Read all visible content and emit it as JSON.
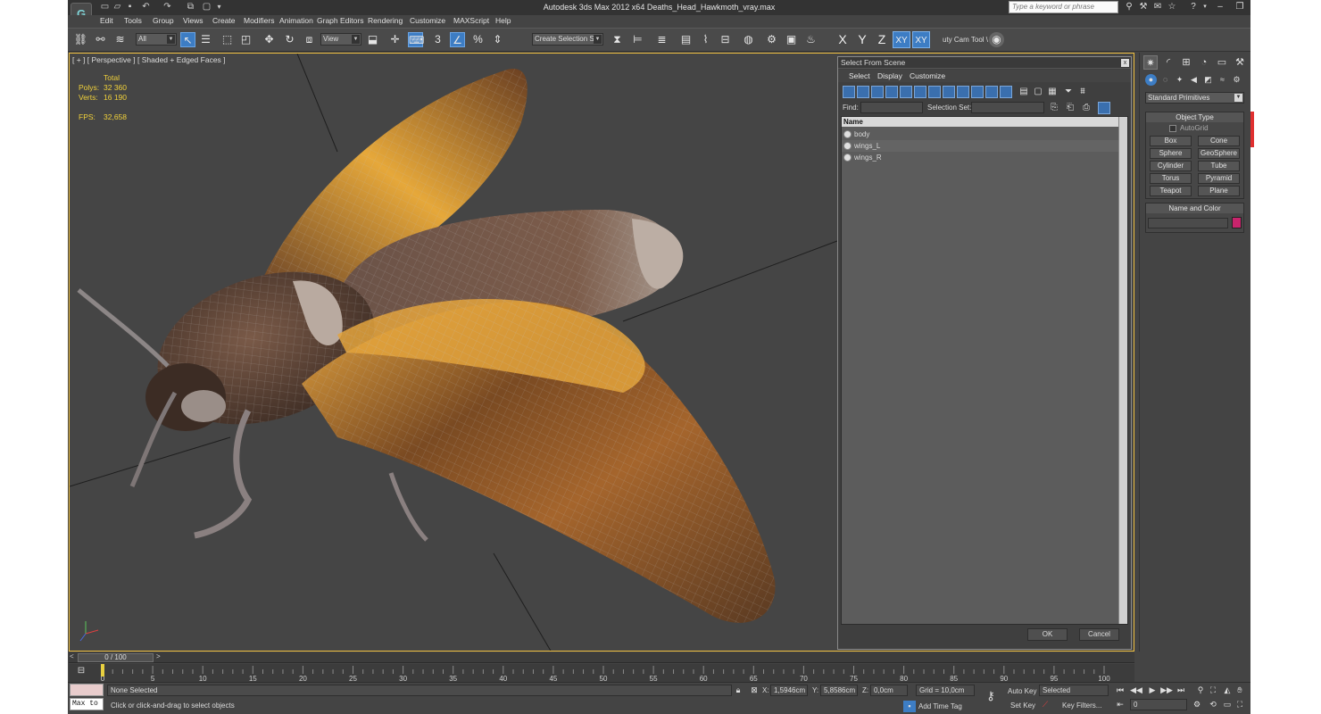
{
  "window": {
    "title": "Autodesk 3ds Max  2012 x64     Deaths_Head_Hawkmoth_vray.max",
    "search_placeholder": "Type a keyword or phrase",
    "logo_text": "G"
  },
  "menu": [
    "Edit",
    "Tools",
    "Group",
    "Views",
    "Create",
    "Modifiers",
    "Animation",
    "Graph Editors",
    "Rendering",
    "Customize",
    "MAXScript",
    "Help"
  ],
  "toolbar": {
    "filter_value": "All",
    "refcoord_value": "View",
    "selection_set_placeholder": "Create Selection Se",
    "axis_x": "X",
    "axis_y": "Y",
    "axis_z": "Z",
    "axis_xy": "XY",
    "axis_xy2": "XY",
    "snap_3": "3",
    "snap_pct": "%",
    "cam_tool_label": "uty Cam Tool \\"
  },
  "viewport": {
    "label": "[ + ] [ Perspective ] [ Shaded + Edged Faces ]",
    "stats": {
      "total_label": "Total",
      "polys_label": "Polys:",
      "polys_value": "32 360",
      "verts_label": "Verts:",
      "verts_value": "16 190",
      "fps_label": "FPS:",
      "fps_value": "32,658"
    }
  },
  "dialog": {
    "title": "Select From Scene",
    "close": "x",
    "menus": [
      "Select",
      "Display",
      "Customize"
    ],
    "find_label": "Find:",
    "selection_set_label": "Selection Set:",
    "column_name": "Name",
    "rows": [
      "body",
      "wings_L",
      "wings_R"
    ],
    "ok": "OK",
    "cancel": "Cancel"
  },
  "command_panel": {
    "category": "Standard Primitives",
    "object_type_title": "Object Type",
    "autogrid_label": "AutoGrid",
    "primitives": [
      "Box",
      "Cone",
      "Sphere",
      "GeoSphere",
      "Cylinder",
      "Tube",
      "Torus",
      "Pyramid",
      "Teapot",
      "Plane"
    ],
    "name_color_title": "Name and Color",
    "color": "#c8246c"
  },
  "timeline": {
    "range": "0 / 100",
    "ticks": [
      0,
      5,
      10,
      15,
      20,
      25,
      30,
      35,
      40,
      45,
      50,
      55,
      60,
      65,
      70,
      75,
      80,
      85,
      90,
      95,
      100
    ],
    "current_frame": 0
  },
  "status": {
    "maxscript": "Max to",
    "selection": "None Selected",
    "prompt": "Click or click-and-drag to select objects",
    "x_label": "X:",
    "x_value": "1,5946cm",
    "y_label": "Y:",
    "y_value": "5,8586cm",
    "z_label": "Z:",
    "z_value": "0,0cm",
    "grid": "Grid = 10,0cm",
    "add_time_tag": "Add Time Tag",
    "auto_key": "Auto Key",
    "set_key": "Set Key",
    "key_mode": "Selected",
    "key_filters": "Key Filters...",
    "frame_value": "0"
  }
}
